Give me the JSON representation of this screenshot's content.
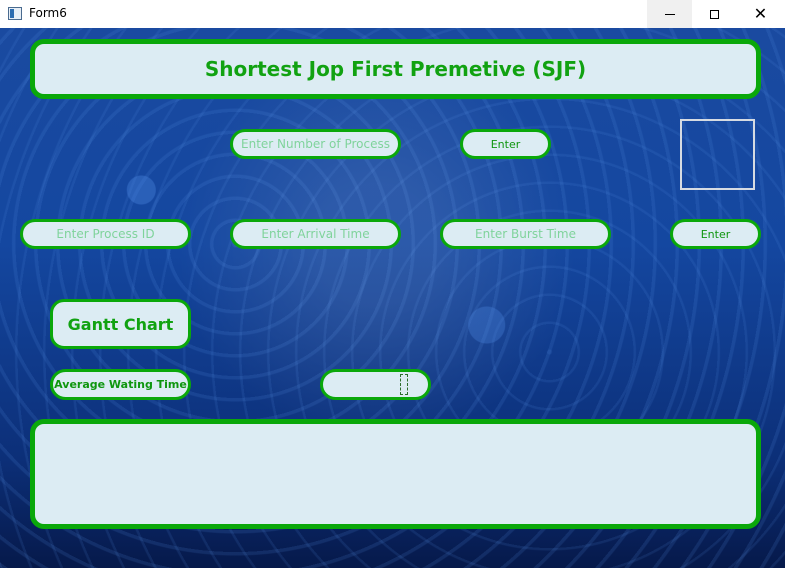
{
  "window": {
    "title": "Form6",
    "controls": {
      "minimize": "—",
      "maximize": "☐",
      "close": "✕"
    }
  },
  "header": {
    "title": "Shortest Jop First Premetive (SJF)"
  },
  "inputs": {
    "number_of_process_placeholder": "Enter Number of Process",
    "process_id_placeholder": "Enter  Process ID",
    "arrival_time_placeholder": "Enter Arrival Time",
    "burst_time_placeholder": "Enter Burst Time"
  },
  "buttons": {
    "enter_process_count": "Enter",
    "enter_process_details": "Enter",
    "gantt_chart": "Gantt Chart",
    "average_waiting_time": "Average Wating Time"
  },
  "output": {
    "average_waiting_time_value": "",
    "result": ""
  },
  "colors": {
    "accent_green": "#0aa80a",
    "field_bg": "#dcecf3",
    "background_blue": "#1447a0"
  },
  "icons": {
    "app": "form-window-icon"
  }
}
